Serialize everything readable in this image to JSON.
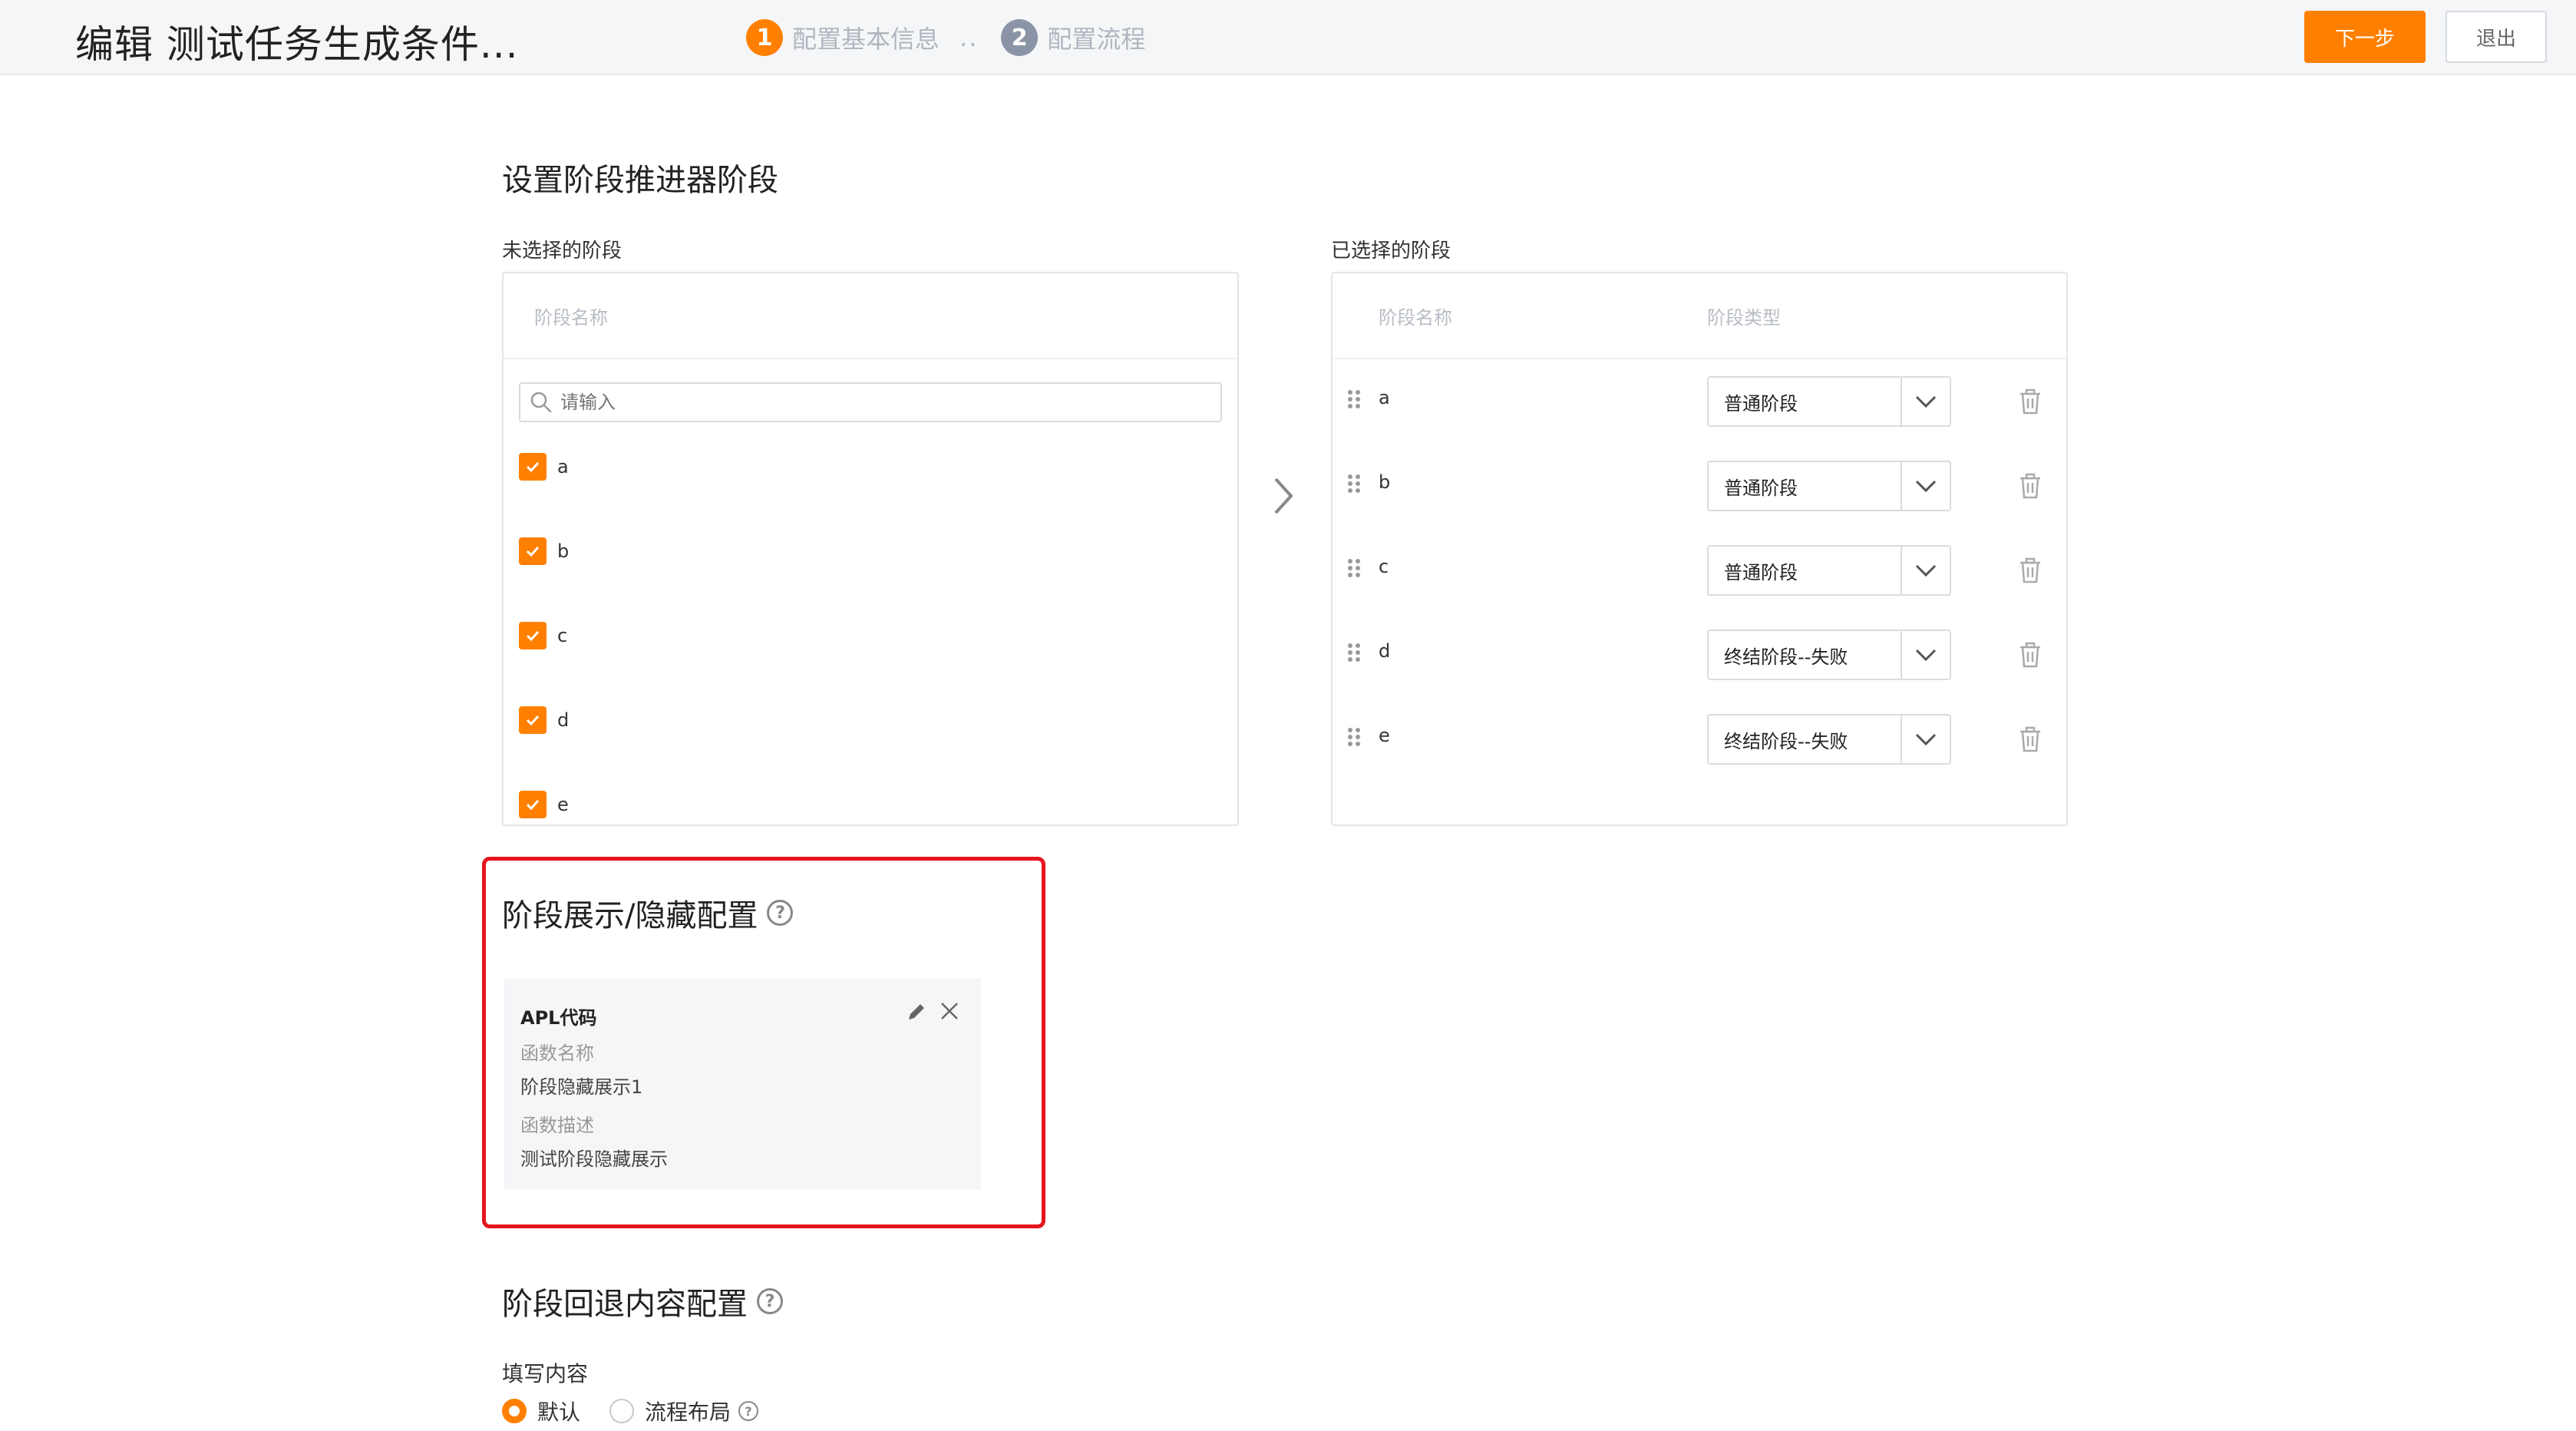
{
  "header": {
    "title": "编辑 测试任务生成条件...",
    "steps": [
      {
        "num": "1",
        "label": "配置基本信息"
      },
      {
        "num": "2",
        "label": "配置流程"
      }
    ],
    "step_separator": "..",
    "next_label": "下一步",
    "exit_label": "退出"
  },
  "stage_section": {
    "title": "设置阶段推进器阶段",
    "unselected_label": "未选择的阶段",
    "selected_label": "已选择的阶段",
    "left_panel": {
      "col_name": "阶段名称",
      "search_placeholder": "请输入",
      "items": [
        "a",
        "b",
        "c",
        "d",
        "e"
      ]
    },
    "right_panel": {
      "col_name": "阶段名称",
      "col_type": "阶段类型",
      "rows": [
        {
          "name": "a",
          "type": "普通阶段"
        },
        {
          "name": "b",
          "type": "普通阶段"
        },
        {
          "name": "c",
          "type": "普通阶段"
        },
        {
          "name": "d",
          "type": "终结阶段--失败"
        },
        {
          "name": "e",
          "type": "终结阶段--失败"
        }
      ]
    }
  },
  "visibility_section": {
    "title": "阶段展示/隐藏配置",
    "card": {
      "title": "APL代码",
      "func_name_key": "函数名称",
      "func_name_value": "阶段隐藏展示1",
      "func_desc_key": "函数描述",
      "func_desc_value": "测试阶段隐藏展示"
    }
  },
  "rollback_section": {
    "title": "阶段回退内容配置",
    "fill_label": "填写内容",
    "options": [
      {
        "label": "默认",
        "selected": true
      },
      {
        "label": "流程布局",
        "selected": false
      }
    ]
  },
  "colors": {
    "accent": "#ff8000",
    "highlight_border": "#e5141e"
  }
}
